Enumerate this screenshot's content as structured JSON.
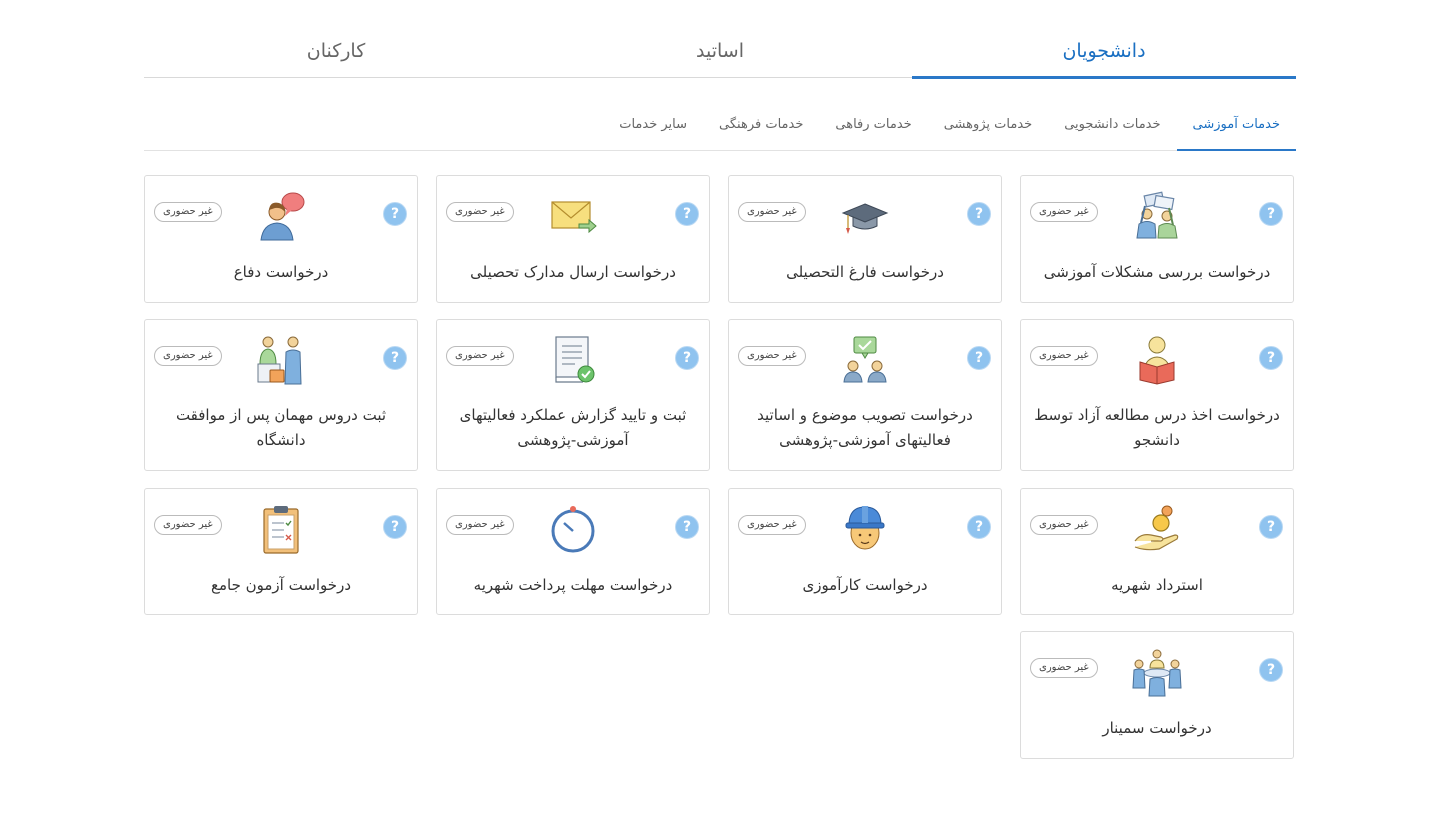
{
  "main_tabs": [
    {
      "label": "دانشجویان",
      "active": true
    },
    {
      "label": "اساتید",
      "active": false
    },
    {
      "label": "کارکنان",
      "active": false
    }
  ],
  "sub_tabs": [
    {
      "label": "خدمات آموزشی",
      "active": true
    },
    {
      "label": "خدمات دانشجویی",
      "active": false
    },
    {
      "label": "خدمات پژوهشی",
      "active": false
    },
    {
      "label": "خدمات رفاهی",
      "active": false
    },
    {
      "label": "خدمات فرهنگی",
      "active": false
    },
    {
      "label": "سایر خدمات",
      "active": false
    }
  ],
  "badge_label": "غیر حضوری",
  "help_symbol": "?",
  "colors": {
    "accent": "#2a78c8",
    "help": "#8fc3ef"
  },
  "cards": [
    {
      "title": "درخواست بررسی مشکلات آموزشی",
      "icon": "people-discussion-icon"
    },
    {
      "title": "درخواست فارغ التحصیلی",
      "icon": "graduation-cap-icon"
    },
    {
      "title": "درخواست ارسال مدارک تحصیلی",
      "icon": "envelope-send-icon"
    },
    {
      "title": "درخواست دفاع",
      "icon": "person-speech-icon"
    },
    {
      "title": "درخواست اخذ درس مطالعه آزاد توسط دانشجو",
      "icon": "student-reading-icon"
    },
    {
      "title": "درخواست تصویب موضوع و اساتید فعالیتهای آموزشی-پژوهشی",
      "icon": "approval-meeting-icon"
    },
    {
      "title": "ثبت و تایید گزارش عملکرد فعالیتهای آموزشی-پژوهشی",
      "icon": "report-check-icon"
    },
    {
      "title": "ثبت دروس مهمان پس از موافقت دانشگاه",
      "icon": "guest-registration-icon"
    },
    {
      "title": "استرداد شهریه",
      "icon": "coin-refund-icon"
    },
    {
      "title": "درخواست کارآموزی",
      "icon": "worker-helmet-icon"
    },
    {
      "title": "درخواست مهلت پرداخت شهریه",
      "icon": "stopwatch-icon"
    },
    {
      "title": "درخواست آزمون جامع",
      "icon": "exam-clipboard-icon"
    },
    {
      "title": "درخواست سمینار",
      "icon": "seminar-group-icon"
    }
  ]
}
